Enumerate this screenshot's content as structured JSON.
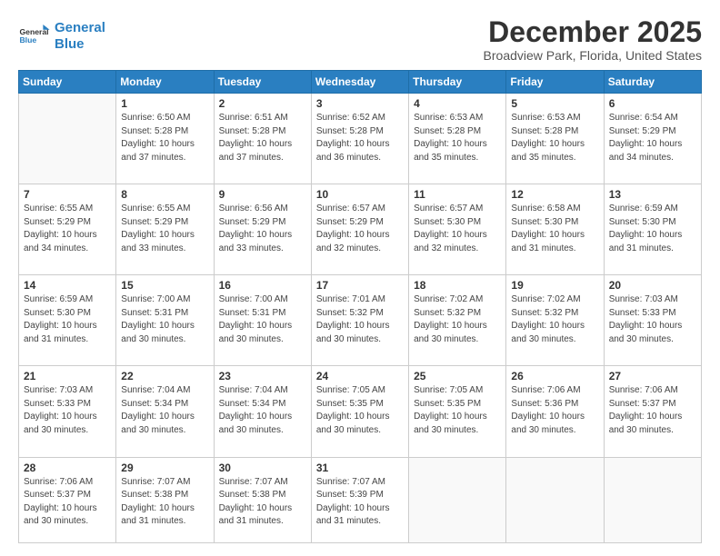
{
  "logo": {
    "line1": "General",
    "line2": "Blue"
  },
  "title": "December 2025",
  "location": "Broadview Park, Florida, United States",
  "weekdays": [
    "Sunday",
    "Monday",
    "Tuesday",
    "Wednesday",
    "Thursday",
    "Friday",
    "Saturday"
  ],
  "weeks": [
    [
      {
        "day": "",
        "info": ""
      },
      {
        "day": "1",
        "info": "Sunrise: 6:50 AM\nSunset: 5:28 PM\nDaylight: 10 hours\nand 37 minutes."
      },
      {
        "day": "2",
        "info": "Sunrise: 6:51 AM\nSunset: 5:28 PM\nDaylight: 10 hours\nand 37 minutes."
      },
      {
        "day": "3",
        "info": "Sunrise: 6:52 AM\nSunset: 5:28 PM\nDaylight: 10 hours\nand 36 minutes."
      },
      {
        "day": "4",
        "info": "Sunrise: 6:53 AM\nSunset: 5:28 PM\nDaylight: 10 hours\nand 35 minutes."
      },
      {
        "day": "5",
        "info": "Sunrise: 6:53 AM\nSunset: 5:28 PM\nDaylight: 10 hours\nand 35 minutes."
      },
      {
        "day": "6",
        "info": "Sunrise: 6:54 AM\nSunset: 5:29 PM\nDaylight: 10 hours\nand 34 minutes."
      }
    ],
    [
      {
        "day": "7",
        "info": "Sunrise: 6:55 AM\nSunset: 5:29 PM\nDaylight: 10 hours\nand 34 minutes."
      },
      {
        "day": "8",
        "info": "Sunrise: 6:55 AM\nSunset: 5:29 PM\nDaylight: 10 hours\nand 33 minutes."
      },
      {
        "day": "9",
        "info": "Sunrise: 6:56 AM\nSunset: 5:29 PM\nDaylight: 10 hours\nand 33 minutes."
      },
      {
        "day": "10",
        "info": "Sunrise: 6:57 AM\nSunset: 5:29 PM\nDaylight: 10 hours\nand 32 minutes."
      },
      {
        "day": "11",
        "info": "Sunrise: 6:57 AM\nSunset: 5:30 PM\nDaylight: 10 hours\nand 32 minutes."
      },
      {
        "day": "12",
        "info": "Sunrise: 6:58 AM\nSunset: 5:30 PM\nDaylight: 10 hours\nand 31 minutes."
      },
      {
        "day": "13",
        "info": "Sunrise: 6:59 AM\nSunset: 5:30 PM\nDaylight: 10 hours\nand 31 minutes."
      }
    ],
    [
      {
        "day": "14",
        "info": "Sunrise: 6:59 AM\nSunset: 5:30 PM\nDaylight: 10 hours\nand 31 minutes."
      },
      {
        "day": "15",
        "info": "Sunrise: 7:00 AM\nSunset: 5:31 PM\nDaylight: 10 hours\nand 30 minutes."
      },
      {
        "day": "16",
        "info": "Sunrise: 7:00 AM\nSunset: 5:31 PM\nDaylight: 10 hours\nand 30 minutes."
      },
      {
        "day": "17",
        "info": "Sunrise: 7:01 AM\nSunset: 5:32 PM\nDaylight: 10 hours\nand 30 minutes."
      },
      {
        "day": "18",
        "info": "Sunrise: 7:02 AM\nSunset: 5:32 PM\nDaylight: 10 hours\nand 30 minutes."
      },
      {
        "day": "19",
        "info": "Sunrise: 7:02 AM\nSunset: 5:32 PM\nDaylight: 10 hours\nand 30 minutes."
      },
      {
        "day": "20",
        "info": "Sunrise: 7:03 AM\nSunset: 5:33 PM\nDaylight: 10 hours\nand 30 minutes."
      }
    ],
    [
      {
        "day": "21",
        "info": "Sunrise: 7:03 AM\nSunset: 5:33 PM\nDaylight: 10 hours\nand 30 minutes."
      },
      {
        "day": "22",
        "info": "Sunrise: 7:04 AM\nSunset: 5:34 PM\nDaylight: 10 hours\nand 30 minutes."
      },
      {
        "day": "23",
        "info": "Sunrise: 7:04 AM\nSunset: 5:34 PM\nDaylight: 10 hours\nand 30 minutes."
      },
      {
        "day": "24",
        "info": "Sunrise: 7:05 AM\nSunset: 5:35 PM\nDaylight: 10 hours\nand 30 minutes."
      },
      {
        "day": "25",
        "info": "Sunrise: 7:05 AM\nSunset: 5:35 PM\nDaylight: 10 hours\nand 30 minutes."
      },
      {
        "day": "26",
        "info": "Sunrise: 7:06 AM\nSunset: 5:36 PM\nDaylight: 10 hours\nand 30 minutes."
      },
      {
        "day": "27",
        "info": "Sunrise: 7:06 AM\nSunset: 5:37 PM\nDaylight: 10 hours\nand 30 minutes."
      }
    ],
    [
      {
        "day": "28",
        "info": "Sunrise: 7:06 AM\nSunset: 5:37 PM\nDaylight: 10 hours\nand 30 minutes."
      },
      {
        "day": "29",
        "info": "Sunrise: 7:07 AM\nSunset: 5:38 PM\nDaylight: 10 hours\nand 31 minutes."
      },
      {
        "day": "30",
        "info": "Sunrise: 7:07 AM\nSunset: 5:38 PM\nDaylight: 10 hours\nand 31 minutes."
      },
      {
        "day": "31",
        "info": "Sunrise: 7:07 AM\nSunset: 5:39 PM\nDaylight: 10 hours\nand 31 minutes."
      },
      {
        "day": "",
        "info": ""
      },
      {
        "day": "",
        "info": ""
      },
      {
        "day": "",
        "info": ""
      }
    ]
  ]
}
